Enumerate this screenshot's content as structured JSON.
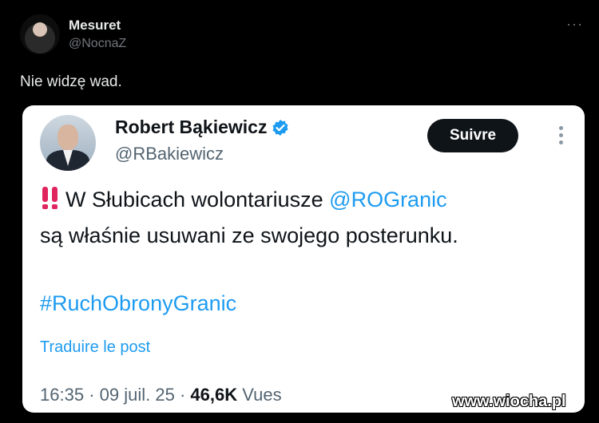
{
  "outer_post": {
    "author_name": "Mesuret",
    "author_handle": "@NocnaZ",
    "more_icon": "more-horizontal-icon",
    "text": "Nie widzę wad."
  },
  "embedded_post": {
    "author_name": "Robert Bąkiewicz",
    "author_handle": "@RBakiewicz",
    "verified": true,
    "follow_label": "Suivre",
    "text_line1_before": "W Słubicach wolontariusze ",
    "mention": "@ROGranic",
    "text_line2": "są właśnie usuwani ze swojego posterunku.",
    "hashtag": "#RuchObronyGranic",
    "translate_label": "Traduire le post",
    "time": "16:35",
    "separator": "·",
    "date": "09 juil. 25",
    "views_count": "46,6K",
    "views_label": "Vues",
    "alert_icon": "double-exclamation-icon",
    "accent_color": "#1d9bf0"
  },
  "watermark": "www.wiocha.pl"
}
